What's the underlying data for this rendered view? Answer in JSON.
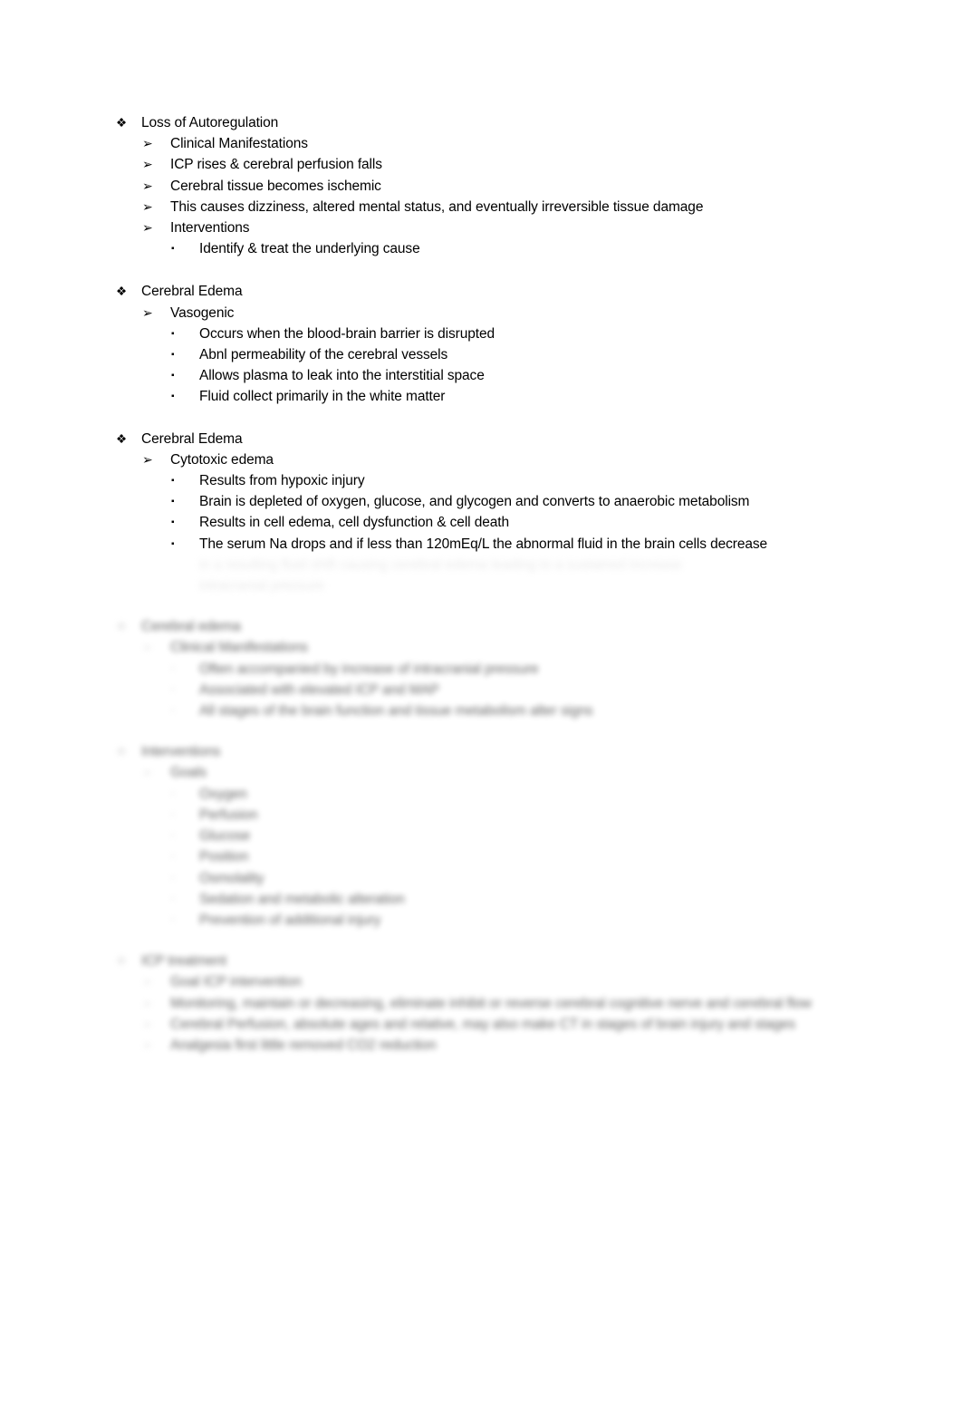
{
  "document": {
    "page_background": "#ffffff",
    "text_color": "#000000",
    "obscured_color": "#d0d0d0",
    "bullets": {
      "level1": "❖",
      "level2": "➢",
      "level3": "▪"
    }
  },
  "sections": [
    {
      "id": "loss-of-autoregulation",
      "heading": "Loss of Autoregulation",
      "obscured": false,
      "items": [
        {
          "level": 2,
          "text": "Clinical Manifestations",
          "obscured": false
        },
        {
          "level": 2,
          "text": "ICP rises & cerebral perfusion falls",
          "obscured": false
        },
        {
          "level": 2,
          "text": "Cerebral tissue becomes ischemic",
          "obscured": false
        },
        {
          "level": 2,
          "text": "This causes dizziness, altered mental status, and eventually irreversible tissue damage",
          "obscured": false
        },
        {
          "level": 2,
          "text": "Interventions",
          "obscured": false
        },
        {
          "level": 3,
          "text": "Identify & treat the underlying cause",
          "obscured": false
        }
      ]
    },
    {
      "id": "cerebral-edema-vasogenic",
      "heading": "Cerebral Edema",
      "obscured": false,
      "items": [
        {
          "level": 2,
          "text": "Vasogenic",
          "obscured": false
        },
        {
          "level": 3,
          "text": "Occurs when the blood-brain barrier is disrupted",
          "obscured": false
        },
        {
          "level": 3,
          "text": "Abnl permeability of the cerebral vessels",
          "obscured": false
        },
        {
          "level": 3,
          "text": "Allows plasma to leak into the interstitial space",
          "obscured": false
        },
        {
          "level": 3,
          "text": "Fluid collect primarily in the white matter",
          "obscured": false
        }
      ]
    },
    {
      "id": "cerebral-edema-cytotoxic",
      "heading": "Cerebral Edema",
      "obscured": false,
      "items": [
        {
          "level": 2,
          "text": "Cytotoxic edema",
          "obscured": false
        },
        {
          "level": 3,
          "text": "Results from hypoxic injury",
          "obscured": false
        },
        {
          "level": 3,
          "text": "Brain is depleted of oxygen, glucose, and glycogen and converts to anaerobic metabolism",
          "obscured": false
        },
        {
          "level": 3,
          "text": "Results in cell edema, cell dysfunction & cell death",
          "obscured": false
        },
        {
          "level": 3,
          "text": "The serum Na drops and if less than 120mEq/L the abnormal fluid in the brain cells decrease",
          "obscured": false
        }
      ]
    }
  ],
  "obscured_content": {
    "note": "Lower portion of page is blurred/faded out and illegible",
    "trailing_lines": [
      {
        "level": 3,
        "continuation": true,
        "text": "in a resulting fluid shift causing cerebral edema leading to a sustained increase",
        "obscured": true
      },
      {
        "level": 3,
        "continuation": true,
        "text": "intracranial pressure",
        "obscured": true
      }
    ],
    "blocks": [
      {
        "id": "obscured-block-1",
        "heading": "Cerebral edema",
        "items": [
          {
            "level": 2,
            "text": "Clinical Manifestations"
          },
          {
            "level": 3,
            "text": "Often accompanied by increase of intracranial pressure"
          },
          {
            "level": 3,
            "text": "Associated with elevated ICP and MAP"
          },
          {
            "level": 3,
            "text": "All stages of the brain function and tissue metabolism alter signs"
          }
        ]
      },
      {
        "id": "obscured-block-2",
        "heading": "Interventions",
        "items": [
          {
            "level": 2,
            "text": "Goals"
          },
          {
            "level": 3,
            "text": "Oxygen"
          },
          {
            "level": 3,
            "text": "Perfusion"
          },
          {
            "level": 3,
            "text": "Glucose"
          },
          {
            "level": 3,
            "text": "Position"
          },
          {
            "level": 3,
            "text": "Osmolality"
          },
          {
            "level": 3,
            "text": "Sedation and metabolic alteration"
          },
          {
            "level": 3,
            "text": "Prevention of additional injury"
          }
        ]
      },
      {
        "id": "obscured-block-3",
        "heading": "ICP treatment",
        "items": [
          {
            "level": 2,
            "text": "Goal ICP intervention"
          },
          {
            "level": 2,
            "text": "Monitoring, maintain or decreasing, eliminate inhibit or reverse cerebral cognitive nerve and cerebral flow"
          },
          {
            "level": 2,
            "text": "Cerebral Perfusion, absolute ages and relative, may also make CT in stages of brain injury and stages"
          },
          {
            "level": 2,
            "text": "Analgesia first little removed CO2 reduction"
          }
        ]
      }
    ]
  }
}
